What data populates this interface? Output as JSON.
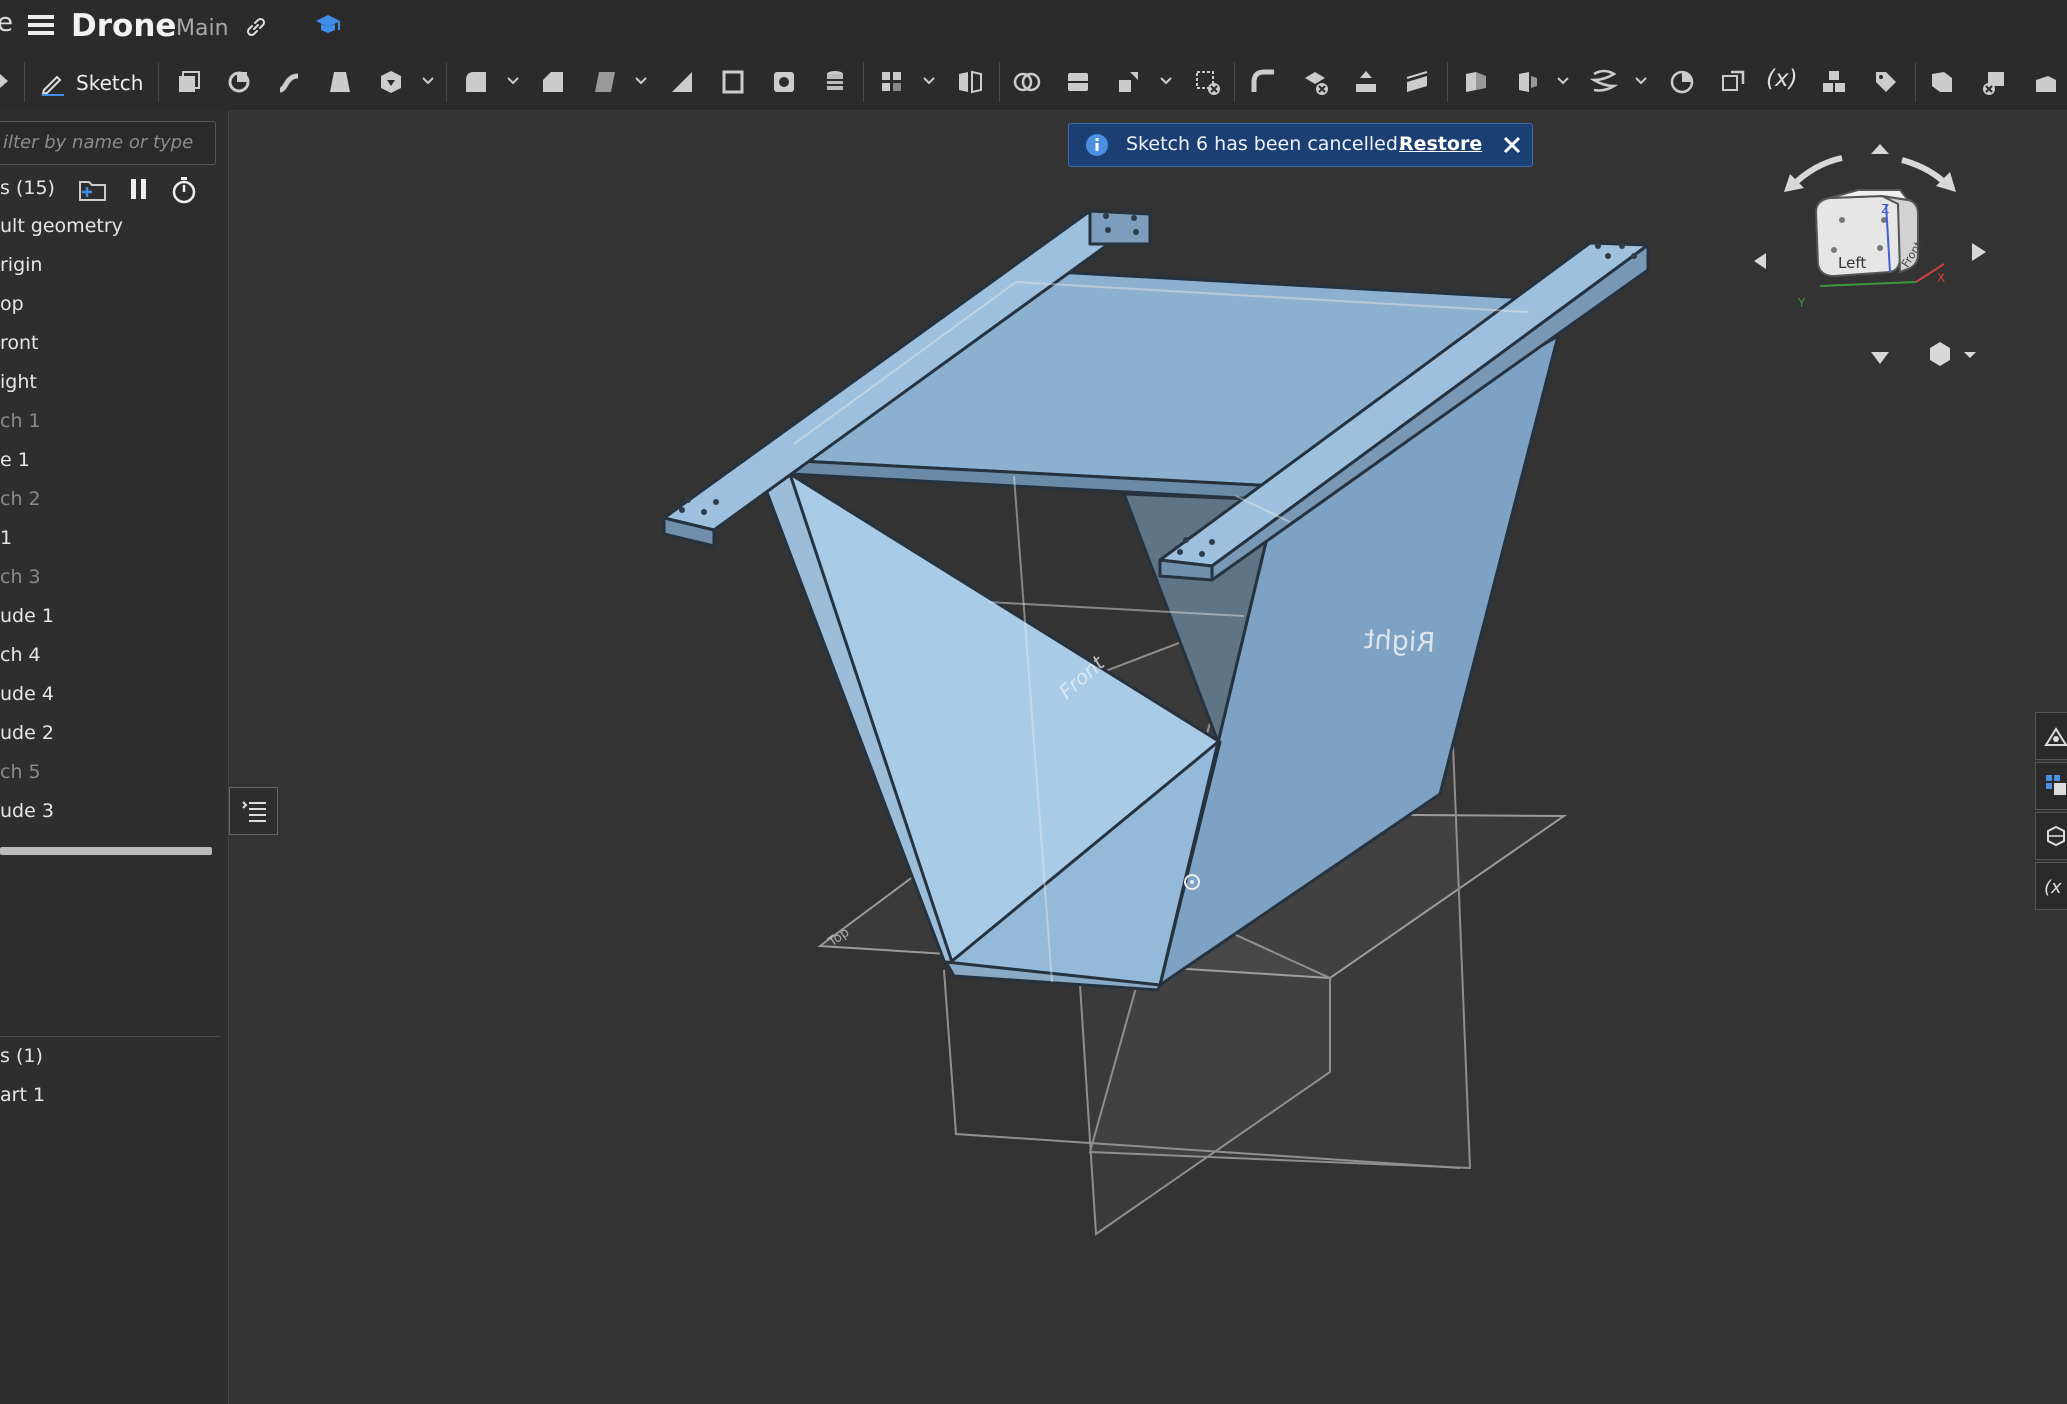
{
  "app": {
    "doc_title": "Drone",
    "branch": "Main",
    "left_cut_char": "e"
  },
  "toolbar": {
    "sketch_label": "Sketch",
    "variable_label": "(x)"
  },
  "sidebar": {
    "filter_placeholder": "ilter by name or type",
    "features_header": "s (15)",
    "features": [
      {
        "label": "ult geometry",
        "dim": false
      },
      {
        "label": "rigin",
        "dim": false
      },
      {
        "label": "op",
        "dim": false
      },
      {
        "label": "ront",
        "dim": false
      },
      {
        "label": "ight",
        "dim": false
      },
      {
        "label": "ch 1",
        "dim": true
      },
      {
        "label": "e 1",
        "dim": false
      },
      {
        "label": "ch 2",
        "dim": true
      },
      {
        "label": "1",
        "dim": false
      },
      {
        "label": "ch 3",
        "dim": true
      },
      {
        "label": "ude 1",
        "dim": false
      },
      {
        "label": "ch 4",
        "dim": false
      },
      {
        "label": "ude 4",
        "dim": false
      },
      {
        "label": "ude 2",
        "dim": false
      },
      {
        "label": "ch 5",
        "dim": true
      },
      {
        "label": "ude 3",
        "dim": false
      }
    ],
    "parts_header": "s (1)",
    "parts": [
      {
        "label": "art 1"
      }
    ]
  },
  "notification": {
    "message": "Sketch 6 has been cancelled.",
    "action": "Restore"
  },
  "viewcube": {
    "face_left": "Left",
    "face_front": "Front",
    "axis_x": "X",
    "axis_y": "Y",
    "axis_z": "Z"
  },
  "viewport": {
    "plane_front": "Front",
    "plane_right": "Right",
    "plane_top": "Top"
  },
  "colors": {
    "part_light": "#a9cbe6",
    "part_mid": "#8fb3d3",
    "part_dark": "#7a9ec0",
    "toast_bg": "#1b3f73"
  }
}
